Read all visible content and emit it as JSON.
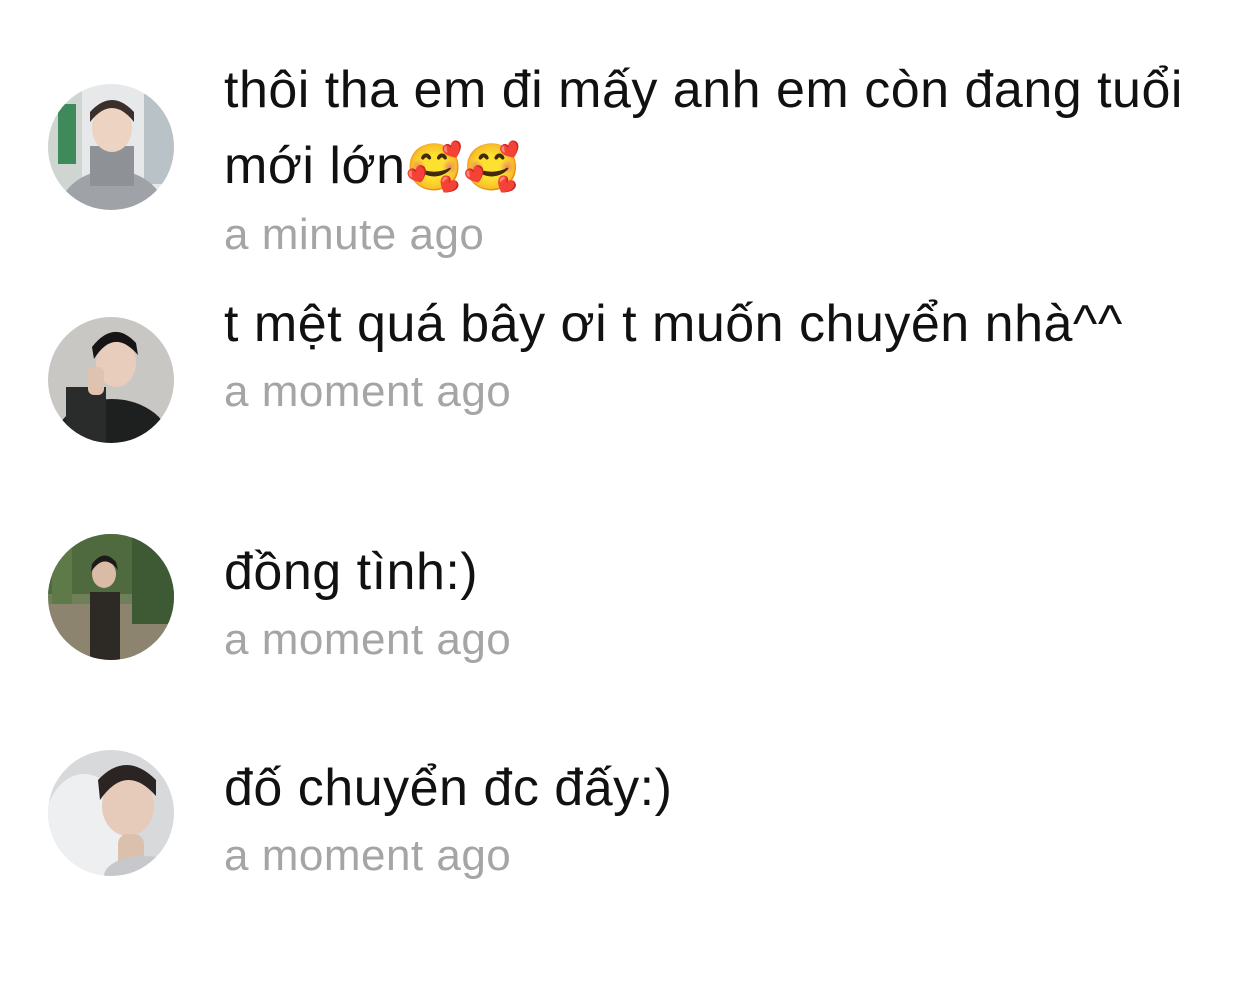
{
  "comments": [
    {
      "text": "thôi tha em đi mấy anh em còn đang tuổi mới lớn",
      "emojis": "🥰🥰",
      "time": "a minute ago"
    },
    {
      "text": "t mệt quá bây ơi t muốn chuyển nhà^^",
      "time": "a moment ago"
    },
    {
      "text": "đồng tình:)",
      "time": "a moment ago"
    },
    {
      "text": "đố chuyển đc đấy:)",
      "time": "a moment ago"
    }
  ],
  "colors": {
    "text": "#111111",
    "timestamp": "#a5a5a5",
    "background": "#ffffff"
  }
}
